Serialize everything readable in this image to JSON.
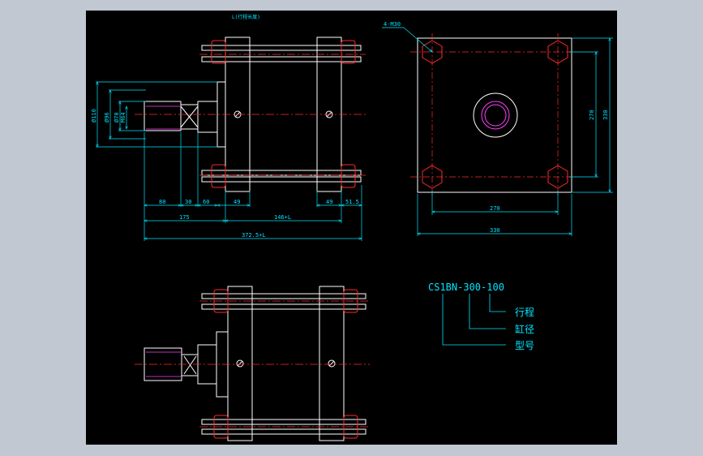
{
  "title_note": "L(行程长度)",
  "dimensions": {
    "dia_outer": "Ø110",
    "dia_mid": "Ø96",
    "dia_70": "Ø70",
    "m64": "M64",
    "len_80": "80",
    "len_30": "30",
    "len_60": "60",
    "len_49_left": "49",
    "len_49_right": "49",
    "len_51_5": "51.5",
    "len_175": "175",
    "len_146L": "146+L",
    "len_total": "372.5+L",
    "bolt_spec": "4-M30",
    "pitch_v": "270",
    "size_v": "330",
    "pitch_h": "270",
    "size_h": "330"
  },
  "legend": {
    "model_code": "CS1BN-300-100",
    "stroke": "行程",
    "bore": "缸径",
    "model": "型号"
  },
  "colors": {
    "background": "#000000",
    "frame": "#c1c8d1",
    "outline": "#ffffff",
    "dimension": "#00e5ff",
    "bolt": "#ff2a2a",
    "centerline": "#ff2a2a",
    "bore": "#ff40ff"
  }
}
